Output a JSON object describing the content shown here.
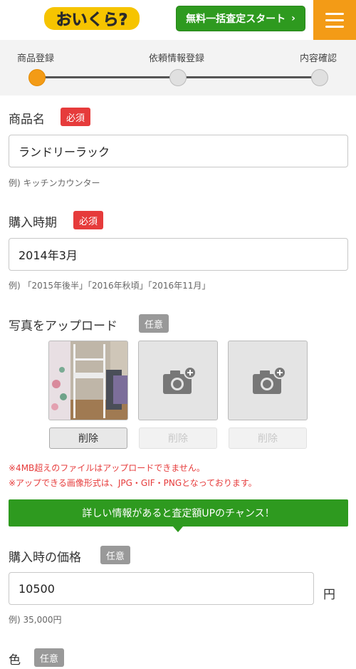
{
  "header": {
    "logo_text": "おいくら?",
    "start_button": "無料一括査定スタート",
    "start_chevron": "›"
  },
  "steps": [
    {
      "label": "商品登録",
      "active": true
    },
    {
      "label": "依頼情報登録",
      "active": false
    },
    {
      "label": "内容確認",
      "active": false
    }
  ],
  "product_name": {
    "label": "商品名",
    "badge": "必須",
    "value": "ランドリーラック",
    "example": "例) キッチンカウンター"
  },
  "purchase_period": {
    "label": "購入時期",
    "badge": "必須",
    "value": "2014年3月",
    "example": "例) 「2015年後半」「2016年秋頃」「2016年11月」"
  },
  "photo_upload": {
    "label": "写真をアップロード",
    "badge": "任意",
    "delete_labels": [
      "削除",
      "削除",
      "削除"
    ],
    "notes": [
      "※4MB超えのファイルはアップロードできません。",
      "※アップできる画像形式は、JPG・GIF・PNGとなっております。"
    ]
  },
  "banner": "詳しい情報があると査定額UPのチャンス！",
  "purchase_price": {
    "label": "購入時の価格",
    "badge": "任意",
    "value": "10500",
    "unit": "円",
    "example": "例) 35,000円"
  },
  "color": {
    "label": "色",
    "badge": "任意"
  },
  "colors": {
    "accent_orange": "#f39b16",
    "green": "#2e9a1f",
    "required_red": "#e63b3b",
    "optional_gray": "#999999"
  }
}
